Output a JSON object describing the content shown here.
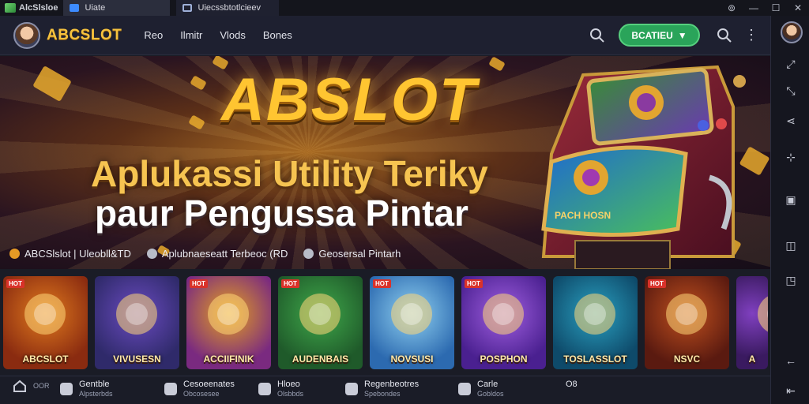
{
  "titlebar": {
    "app_name": "AlcSlsloe",
    "tabs": [
      {
        "label": "Uiate"
      },
      {
        "label": "Uiecssbtotlcieev"
      }
    ],
    "controls": [
      "⊚",
      "—",
      "☐",
      "✕"
    ]
  },
  "topbar": {
    "brand": "ABCSLOT",
    "nav": [
      "Reo",
      "Ilmitr",
      "Vlods",
      "Bones"
    ],
    "cta_label": "BCATIEU",
    "more": "⋮"
  },
  "banner": {
    "title": "ABSLOT",
    "line1": "Aplukassi Utility Teriky",
    "line2": "paur Pengussa Pintar",
    "machine_label": "PACH HOSN",
    "tags": [
      {
        "label": "ABCSlslot | Uleobll&TD",
        "color": "#e59a25"
      },
      {
        "label": "Aplubnaeseatt Terbeoc (RD",
        "color": "#b8bcc8"
      },
      {
        "label": "Geosersal Pintarh",
        "color": "#b8bcc8"
      }
    ]
  },
  "games": [
    {
      "label": "ABCSLOT",
      "badge": "HOT",
      "colors": [
        "#8a2b10",
        "#e07a1e"
      ]
    },
    {
      "label": "VIVUSESN",
      "badge": "",
      "colors": [
        "#2f2a6a",
        "#6a4bc0"
      ]
    },
    {
      "label": "ACCIIFINIK",
      "badge": "HOT",
      "colors": [
        "#7a2a80",
        "#e5a020"
      ]
    },
    {
      "label": "AUDENBAIS",
      "badge": "HOT",
      "colors": [
        "#1f5a2a",
        "#3fa84a"
      ]
    },
    {
      "label": "NOVSUSI",
      "badge": "HOT",
      "colors": [
        "#2c6ab0",
        "#8fd0f0"
      ]
    },
    {
      "label": "POSPHON",
      "badge": "HOT",
      "colors": [
        "#4a2090",
        "#a05fe0"
      ]
    },
    {
      "label": "TOSLASSLOT",
      "badge": "",
      "colors": [
        "#0e4a6a",
        "#2aa0c0"
      ]
    },
    {
      "label": "NSVC",
      "badge": "HOT",
      "colors": [
        "#5a1a10",
        "#c0501e"
      ]
    },
    {
      "label": "A",
      "badge": "",
      "colors": [
        "#3a1a60",
        "#8040c0"
      ]
    }
  ],
  "bottomnav": [
    {
      "title": "",
      "sub": "OOR"
    },
    {
      "title": "Gentble",
      "sub": "Alpsterbds"
    },
    {
      "title": "Cesoeenates",
      "sub": "Obcosesee"
    },
    {
      "title": "Hloeo",
      "sub": "Olsbbds"
    },
    {
      "title": "Regenbeotres",
      "sub": "Spebondes"
    },
    {
      "title": "Carle",
      "sub": "Gobldos"
    },
    {
      "title": "O8",
      "sub": ""
    }
  ],
  "sidebar_icons": [
    "expand-icon",
    "collapse-icon",
    "share-icon",
    "location-icon",
    "media-icon",
    "screenshot-icon",
    "window-icon",
    "back-icon",
    "return-icon"
  ]
}
